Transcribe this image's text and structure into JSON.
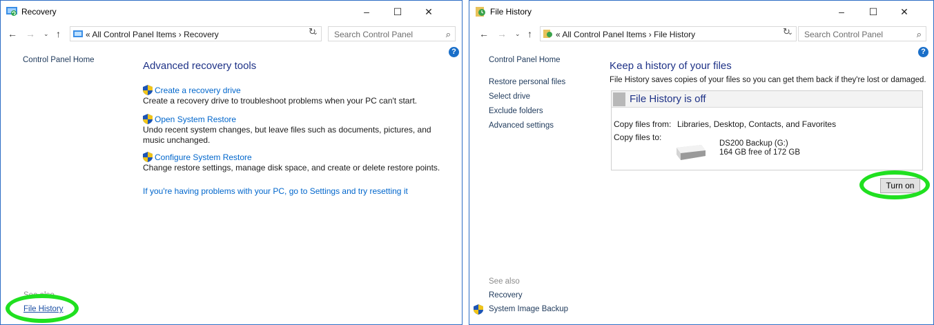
{
  "accent_color": "#20e020",
  "recovery_window": {
    "title": "Recovery",
    "controls": {
      "minimize": "–",
      "maximize": "☐",
      "close": "✕"
    },
    "address": {
      "prefix": "«",
      "path": "All Control Panel Items",
      "separator": "›",
      "current": "Recovery"
    },
    "search_placeholder": "Search Control Panel",
    "help_icon": "?",
    "sidebar": {
      "home": "Control Panel Home"
    },
    "heading": "Advanced recovery tools",
    "tools": [
      {
        "link": "Create a recovery drive",
        "description": "Create a recovery drive to troubleshoot problems when your PC can't start.",
        "icon": "shield-icon"
      },
      {
        "link": "Open System Restore",
        "description": "Undo recent system changes, but leave files such as documents, pictures, and music unchanged.",
        "icon": "shield-icon"
      },
      {
        "link": "Configure System Restore",
        "description": "Change restore settings, manage disk space, and create or delete restore points.",
        "icon": "shield-icon"
      }
    ],
    "reset_link": "If you're having problems with your PC, go to Settings and try resetting it",
    "see_also": {
      "label": "See also",
      "links": [
        "File History"
      ]
    }
  },
  "file_history_window": {
    "title": "File History",
    "controls": {
      "minimize": "–",
      "maximize": "☐",
      "close": "✕"
    },
    "address": {
      "prefix": "«",
      "path": "All Control Panel Items",
      "separator": "›",
      "current": "File History"
    },
    "search_placeholder": "Search Control Panel",
    "help_icon": "?",
    "sidebar": {
      "home": "Control Panel Home",
      "links": [
        "Restore personal files",
        "Select drive",
        "Exclude folders",
        "Advanced settings"
      ]
    },
    "heading": "Keep a history of your files",
    "subtext": "File History saves copies of your files so you can get them back if they're lost or damaged.",
    "status": "File History is off",
    "copy_from_label": "Copy files from:",
    "copy_from_value": "Libraries, Desktop, Contacts, and Favorites",
    "copy_to_label": "Copy files to:",
    "drive_name": "DS200 Backup (G:)",
    "drive_space": "164 GB free of 172 GB",
    "turn_on_button": "Turn on",
    "see_also": {
      "label": "See also",
      "links": [
        "Recovery",
        "System Image Backup"
      ]
    }
  }
}
